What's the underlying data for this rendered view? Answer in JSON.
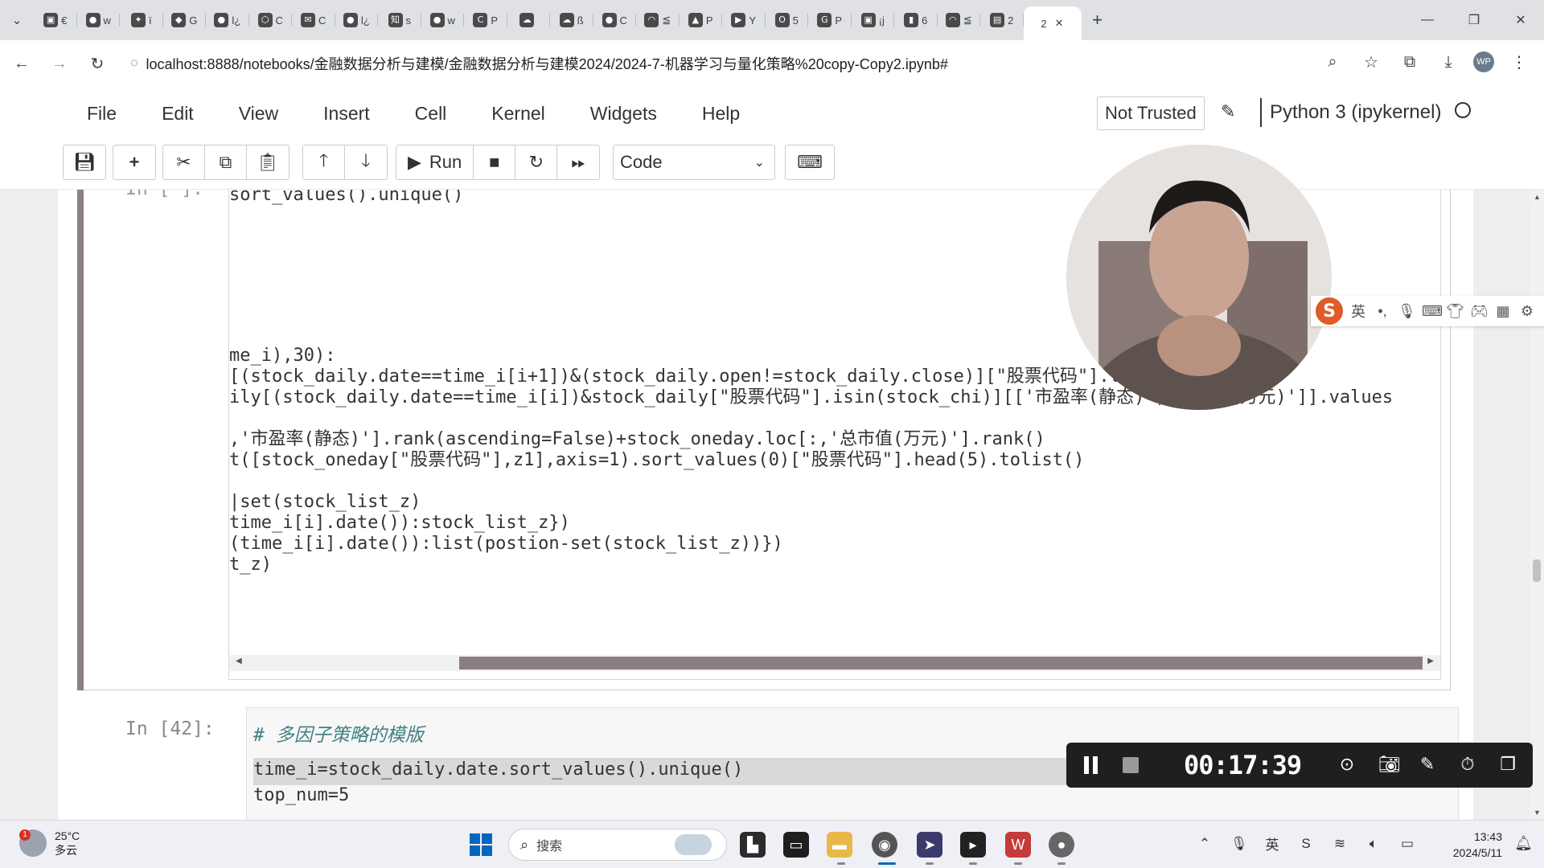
{
  "browser": {
    "tabs": [
      {
        "icon": "bilibili-icon",
        "glyph": "▣",
        "label": "€"
      },
      {
        "icon": "github-icon",
        "glyph": "●",
        "label": "w"
      },
      {
        "icon": "swift-icon",
        "glyph": "✦",
        "label": "ï"
      },
      {
        "icon": "plugin-icon",
        "glyph": "◆",
        "label": "G"
      },
      {
        "icon": "github-icon",
        "glyph": "●",
        "label": "l¿"
      },
      {
        "icon": "cube-icon",
        "glyph": "⬡",
        "label": "C"
      },
      {
        "icon": "mail-icon",
        "glyph": "✉",
        "label": "C"
      },
      {
        "icon": "github-icon",
        "glyph": "●",
        "label": "l¿"
      },
      {
        "icon": "zhihu-icon",
        "glyph": "知",
        "label": "s"
      },
      {
        "icon": "github-icon",
        "glyph": "●",
        "label": "w"
      },
      {
        "icon": "c-icon",
        "glyph": "C",
        "label": "P"
      },
      {
        "icon": "cloud-icon",
        "glyph": "☁",
        "label": ""
      },
      {
        "icon": "cloud-icon",
        "glyph": "☁",
        "label": "ß"
      },
      {
        "icon": "github-icon",
        "glyph": "●",
        "label": "C"
      },
      {
        "icon": "loading-icon",
        "glyph": "◠",
        "label": "≦"
      },
      {
        "icon": "graduation-icon",
        "glyph": "▲",
        "label": "P"
      },
      {
        "icon": "youtube-icon",
        "glyph": "▶",
        "label": "Y"
      },
      {
        "icon": "o-icon",
        "glyph": "O",
        "label": "5"
      },
      {
        "icon": "g-icon",
        "glyph": "G",
        "label": "P"
      },
      {
        "icon": "bilibili-icon",
        "glyph": "▣",
        "label": "¡j"
      },
      {
        "icon": "chart-icon",
        "glyph": "▮",
        "label": "6"
      },
      {
        "icon": "loading-icon",
        "glyph": "◠",
        "label": "≦"
      },
      {
        "icon": "page-icon",
        "glyph": "▤",
        "label": "2"
      }
    ],
    "active_tab": {
      "label": "2"
    },
    "url": "localhost:8888/notebooks/金融数据分析与建模/金融数据分析与建模2024/2024-7-机器学习与量化策略%20copy-Copy2.ipynb#"
  },
  "jupyter": {
    "menus": [
      "File",
      "Edit",
      "View",
      "Insert",
      "Cell",
      "Kernel",
      "Widgets",
      "Help"
    ],
    "trust_status": "Not Trusted",
    "kernel_name": "Python 3 (ipykernel)",
    "toolbar": {
      "run_label": "Run",
      "cell_type": "Code"
    }
  },
  "cells": {
    "previous": {
      "prompt": "In  [ ]:",
      "top_line": "sort_values().unique()",
      "lines": [
        "me_i),30):",
        "[(stock_daily.date==time_i[i+1])&(stock_daily.open!=stock_daily.close)][\"股票代码\"].tolist()",
        "ily[(stock_daily.date==time_i[i])&stock_daily[\"股票代码\"].isin(stock_chi)][['市盈率(静态)','总市值(万元)']].values",
        "",
        ",'市盈率(静态)'].rank(ascending=False)+stock_oneday.loc[:,'总市值(万元)'].rank()",
        "t([stock_oneday[\"股票代码\"],z1],axis=1).sort_values(0)[\"股票代码\"].head(5).tolist()",
        "",
        "|set(stock_list_z)",
        "time_i[i].date()):stock_list_z})",
        "(time_i[i].date()):list(postion-set(stock_list_z))})",
        "t_z)"
      ]
    },
    "next": {
      "prompt": "In  [42]:",
      "comment": "# 多因子策略的模版",
      "line1": "time_i=stock_daily.date.sort_values().unique()",
      "line2": "top_num=5"
    }
  },
  "ime": {
    "logo": "S",
    "lang": "英"
  },
  "recorder": {
    "timer": "00:17:39"
  },
  "taskbar": {
    "weather_temp": "25°C",
    "weather_desc": "多云",
    "weather_badge": "1",
    "search_placeholder": "搜索",
    "time": "13:43",
    "date": "2024/5/11"
  }
}
